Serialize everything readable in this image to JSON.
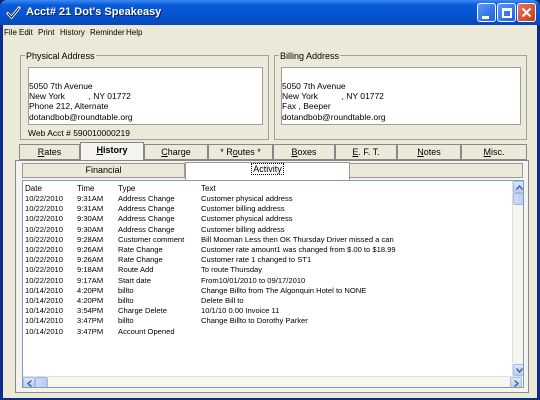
{
  "window": {
    "title": "Acct#  21 Dot's Speakeasy"
  },
  "menu": [
    "File",
    "Edit",
    "Print",
    "History",
    "Reminder",
    "Help"
  ],
  "physical_address": {
    "legend": "Physical Address",
    "lines": [
      "5050 7th Avenue",
      "New York          , NY 01772",
      "Phone 212, Alternate",
      "dotandbob@roundtable.org"
    ],
    "web_acct": "Web Acct # 590010000219"
  },
  "billing_address": {
    "legend": "Billing Address",
    "lines": [
      "5050 7th Avenue",
      "New York          , NY 01772",
      "Fax , Beeper",
      "dotandbob@roundtable.org"
    ]
  },
  "tabs": [
    {
      "u": "R",
      "rest": "ates"
    },
    {
      "u": "H",
      "rest": "istory"
    },
    {
      "u": "C",
      "rest": "harge"
    },
    {
      "pre": "* R",
      "u": "o",
      "rest": "utes *"
    },
    {
      "u": "B",
      "rest": "oxes"
    },
    {
      "u": "E",
      "rest": ". F. T."
    },
    {
      "u": "N",
      "rest": "otes"
    },
    {
      "u": "M",
      "rest": "isc."
    }
  ],
  "subtabs": {
    "financial": "Financial",
    "activity": "Activity"
  },
  "columns": {
    "date": "Date",
    "time": "Time",
    "type": "Type",
    "text": "Text"
  },
  "rows": [
    {
      "date": "10/22/2010",
      "time": "9:31AM",
      "type": "Address Change",
      "text": "Customer physical address"
    },
    {
      "date": "10/22/2010",
      "time": "9:31AM",
      "type": "Address Change",
      "text": "Customer billing address"
    },
    {
      "date": "10/22/2010",
      "time": "9:30AM",
      "type": "Address Change",
      "text": "Customer physical address"
    },
    {
      "date": "10/22/2010",
      "time": "9:30AM",
      "type": "Address Change",
      "text": "Customer billing address"
    },
    {
      "date": "10/22/2010",
      "time": "9:28AM",
      "type": "Customer comment",
      "text": "Bill Mooman                Less then OK          Thursday          Driver missed a can"
    },
    {
      "date": "10/22/2010",
      "time": "9:26AM",
      "type": "Rate Change",
      "text": "Customer rate amount1 was changed from $.00 to $18.99"
    },
    {
      "date": "10/22/2010",
      "time": "9:26AM",
      "type": "Rate Change",
      "text": "Customer rate 1 changed to ST1"
    },
    {
      "date": "10/22/2010",
      "time": "9:18AM",
      "type": "Route Add",
      "text": "To route Thursday"
    },
    {
      "date": "10/22/2010",
      "time": "9:17AM",
      "type": "Start date",
      "text": "From10/01/2010 to 09/17/2010"
    },
    {
      "date": "10/14/2010",
      "time": "4:20PM",
      "type": "billto",
      "text": "Change Billto from The Algonquin Hotel to NONE"
    },
    {
      "date": "10/14/2010",
      "time": "4:20PM",
      "type": "billto",
      "text": "Delete Bill to"
    },
    {
      "date": "10/14/2010",
      "time": "3:54PM",
      "type": "Charge Delete",
      "text": " 10/1/10   0.00  Invoice  11"
    },
    {
      "date": "10/14/2010",
      "time": "3:47PM",
      "type": "billto",
      "text": "Change Billto to Dorothy Parker"
    },
    {
      "date": "10/14/2010",
      "time": "3:47PM",
      "type": "Account Opened",
      "text": ""
    }
  ]
}
